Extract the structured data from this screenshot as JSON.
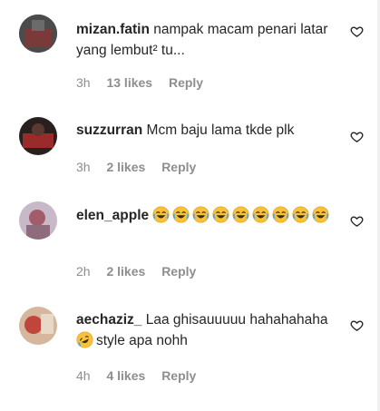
{
  "comments": [
    {
      "username": "mizan.fatin",
      "text": "nampak macam penari latar yang lembut² tu...",
      "time": "3h",
      "likes": "13 likes",
      "reply": "Reply",
      "avatar_colors": [
        "#3b3b3b",
        "#7a3a3a"
      ]
    },
    {
      "username": "suzzurran",
      "text": "Mcm baju lama tkde plk",
      "time": "3h",
      "likes": "2 likes",
      "reply": "Reply",
      "avatar_colors": [
        "#2a1f1f",
        "#9b2b2b"
      ]
    },
    {
      "username": "elen_apple",
      "text": "😂😂😂😂😂😂😂😂😂",
      "time": "2h",
      "likes": "2 likes",
      "reply": "Reply",
      "avatar_colors": [
        "#c8b9c9",
        "#a35c6a"
      ]
    },
    {
      "username": "aechaziz_",
      "text_before": "Laa ghisauuuuu hahahahaha",
      "emoji": "🤣",
      "text_after": "style apa nohh",
      "time": "4h",
      "likes": "4 likes",
      "reply": "Reply",
      "avatar_colors": [
        "#d6b79d",
        "#c0453a"
      ]
    }
  ],
  "icons": {
    "like": "heart-outline-icon",
    "laugh": "face-with-tears-of-joy-emoji",
    "rofl": "rolling-on-floor-laughing-emoji"
  },
  "colors": {
    "text": "#262626",
    "muted": "#8e8e8e",
    "emoji": "#f7c23a"
  }
}
